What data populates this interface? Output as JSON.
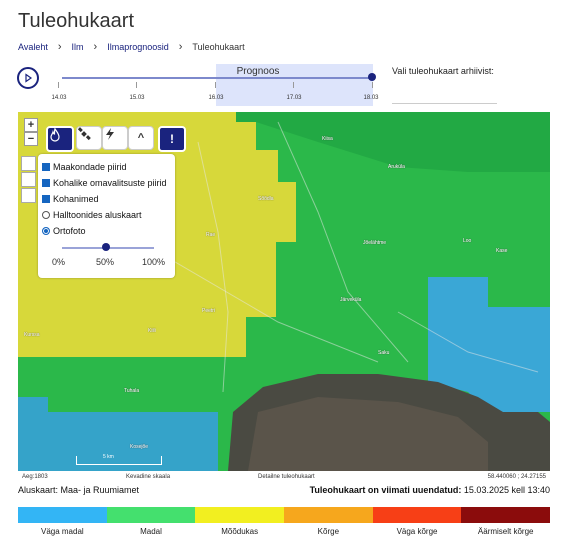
{
  "page": {
    "title": "Tuleohukaart"
  },
  "breadcrumb": [
    {
      "label": "Avaleht"
    },
    {
      "label": "Ilm"
    },
    {
      "label": "Ilmaprognoosid"
    },
    {
      "label": "Tuleohukaart"
    }
  ],
  "timeline": {
    "prognoos_label": "Prognoos",
    "dates": [
      "14.03",
      "15.03",
      "16.03",
      "17.03",
      "18.03"
    ],
    "selected": "18.03",
    "archive_label": "Vali tuleohukaart arhiivist:"
  },
  "map_controls": {
    "zoom_in": "+",
    "zoom_out": "−",
    "expand_label": "^",
    "alert_label": "!"
  },
  "layers": {
    "items": [
      {
        "label": "Maakondade piirid",
        "type": "checkbox",
        "checked": true
      },
      {
        "label": "Kohalike omavalitsuste piirid",
        "type": "checkbox",
        "checked": true
      },
      {
        "label": "Kohanimed",
        "type": "checkbox",
        "checked": true
      },
      {
        "label": "Halltoonides aluskaart",
        "type": "radio",
        "checked": false
      },
      {
        "label": "Ortofoto",
        "type": "radio",
        "checked": true
      }
    ],
    "opacity_value": 0.5,
    "opacity_labels": [
      "0%",
      "50%",
      "100%"
    ]
  },
  "places": [
    "Kiisa",
    "Aruküla",
    "Sõõdla",
    "Jõelähtme",
    "Loo",
    "Rae",
    "Peetri",
    "Kase",
    "Järveküla",
    "Saku",
    "Kiili",
    "Tuhala",
    "Kurssa",
    "Kosejõe"
  ],
  "map_footer": {
    "zoom": "Aeg:1803",
    "base": "Kevadine skaala",
    "detail": "Detailne tuleohukaart",
    "coords": "58.440060 ; 24.27155",
    "scale": "5 km"
  },
  "source": {
    "basemap": "Aluskaart: Maa- ja Ruumiamet",
    "updated_prefix": "Tuleohukaart on viimati uuendatud:",
    "updated_value": "15.03.2025 kell 13:40"
  },
  "legend": [
    {
      "label": "Väga madal",
      "color": "#33b5f5"
    },
    {
      "label": "Madal",
      "color": "#44e06e"
    },
    {
      "label": "Mõõdukas",
      "color": "#f2ef20"
    },
    {
      "label": "Kõrge",
      "color": "#f6a71d"
    },
    {
      "label": "Väga kõrge",
      "color": "#f73f16"
    },
    {
      "label": "Äärmiselt kõrge",
      "color": "#8b0c0c"
    }
  ],
  "colors": {
    "accent": "#1a237e",
    "prognoos_band": "#dde4fb"
  }
}
